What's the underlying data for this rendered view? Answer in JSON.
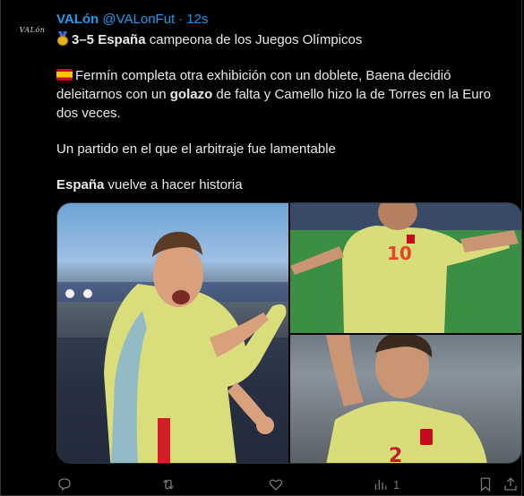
{
  "post": {
    "author_name": "VALón",
    "handle": "@VALonFut",
    "separator": "·",
    "timestamp": "12s",
    "avatar_text": "VALón",
    "line1_bold": "3–5 España",
    "line1_rest": " campeona de los Juegos Olímpicos",
    "para2_a": "Fermín completa otra exhibición con un doblete, Baena decidió deleitarnos con un ",
    "para2_bold": "golazo",
    "para2_b": " de falta y Camello hizo la de Torres en la Euro dos veces.",
    "para3": "Un partido en el que el arbitraje fue lamentable",
    "para4_bold": "España",
    "para4_rest": " vuelve a hacer historia",
    "jersey_number": "10",
    "views_count": "1"
  },
  "icons": {
    "medal": "medal-icon",
    "flag": "spain-flag-icon",
    "reply": "reply-icon",
    "repost": "repost-icon",
    "like": "like-icon",
    "views": "views-icon",
    "bookmark": "bookmark-icon",
    "share": "share-icon"
  },
  "colors": {
    "background": "#000000",
    "accent": "#1d9bf0",
    "text": "#e7e9ea",
    "muted": "#71767b"
  }
}
